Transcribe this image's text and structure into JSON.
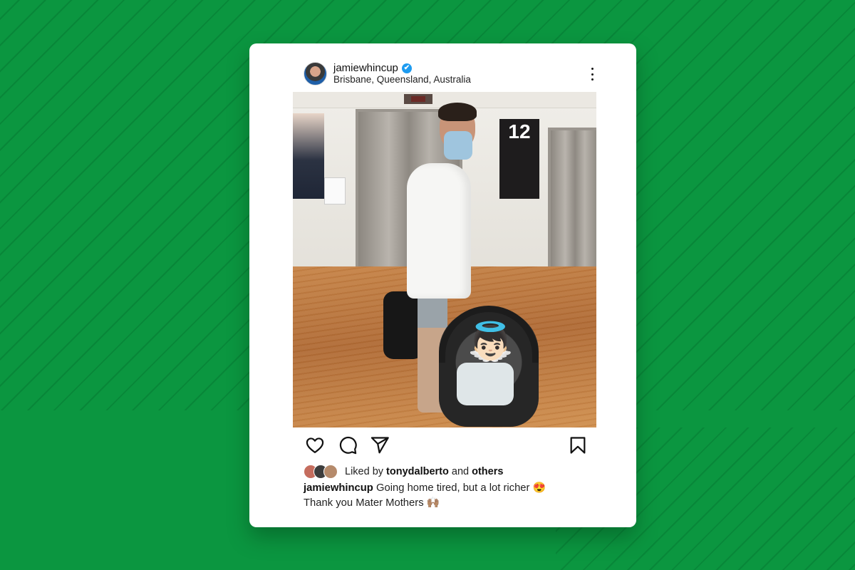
{
  "post": {
    "username": "jamiewhincup",
    "verified": true,
    "location": "Brisbane, Queensland, Australia",
    "photo_sign_number": "12",
    "likes": {
      "prefix": "Liked by",
      "user": "tonydalberto",
      "and": "and",
      "others": "others"
    },
    "caption": {
      "user": "jamiewhincup",
      "line1": "Going home tired, but a lot richer 😍",
      "line2": "Thank you Mater Mothers 🙌🏽"
    }
  },
  "icons": {
    "verified": "✔",
    "more": "more-options-icon",
    "like": "heart-icon",
    "comment": "comment-icon",
    "share": "share-icon",
    "save": "bookmark-icon",
    "baby_overlay": "👼🏻"
  },
  "colors": {
    "background": "#0b9640",
    "verified": "#1d9bf0"
  }
}
